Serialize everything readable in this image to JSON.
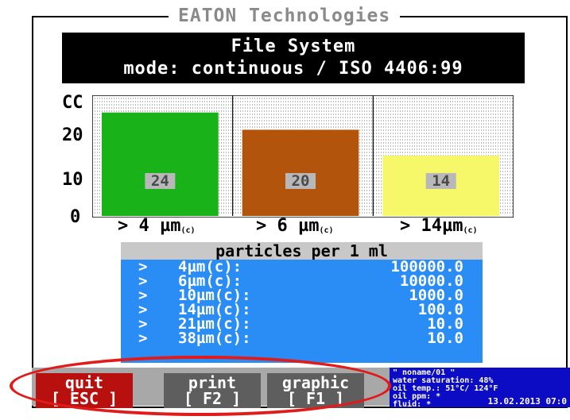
{
  "app": {
    "brand": "EATON Technologies",
    "title": "File System",
    "mode": "mode: continuous / ISO 4406:99"
  },
  "chart_data": {
    "type": "bar",
    "ylabel": "CC",
    "yticks": [
      "20",
      "10",
      "0"
    ],
    "ylim": [
      0,
      28
    ],
    "categories": [
      "> 4 µm(c)",
      "> 6 µm(c)",
      "> 14µm(c)"
    ],
    "category_labels": [
      {
        "main": "> 4 µm",
        "sub": "(c)"
      },
      {
        "main": "> 6 µm",
        "sub": "(c)"
      },
      {
        "main": "> 14µm",
        "sub": "(c)"
      }
    ],
    "values": [
      24,
      20,
      14
    ],
    "value_labels": [
      "24",
      "20",
      "14"
    ],
    "colors": [
      "#19b219",
      "#b2540c",
      "#f7f76a"
    ],
    "grid": true
  },
  "particles": {
    "header": "particles per 1 ml",
    "rows": [
      {
        "mark": ">",
        "label": "4µm(c):",
        "value": "100000.0"
      },
      {
        "mark": ">",
        "label": "6µm(c):",
        "value": "10000.0"
      },
      {
        "mark": ">",
        "label": "10µm(c):",
        "value": "1000.0"
      },
      {
        "mark": ">",
        "label": "14µm(c):",
        "value": "100.0"
      },
      {
        "mark": ">",
        "label": "21µm(c):",
        "value": "10.0"
      },
      {
        "mark": ">",
        "label": "38µm(c):",
        "value": "10.0"
      }
    ]
  },
  "keys": {
    "quit": {
      "label": "quit",
      "key": "[ ESC ]"
    },
    "print": {
      "label": "print",
      "key": "[ F2 ]"
    },
    "graphic": {
      "label": "graphic",
      "key": "[ F1 ]"
    }
  },
  "status": {
    "file": "\" noname/01 \"",
    "water": "water saturation: 48%",
    "oil": "oil temp.: 51°C/ 124°F",
    "ppm": "oil ppm: *",
    "fluid": "fluid: *",
    "datetime": "13.02.2013 07:0"
  },
  "colors": {
    "header_bg": "#000000",
    "table_bg": "#2a8cf5",
    "quit_bg": "#b80f0f",
    "fkey_bg": "#5e5e5e",
    "status_bg": "#0c0cc4",
    "highlight": "#e11a1a"
  }
}
